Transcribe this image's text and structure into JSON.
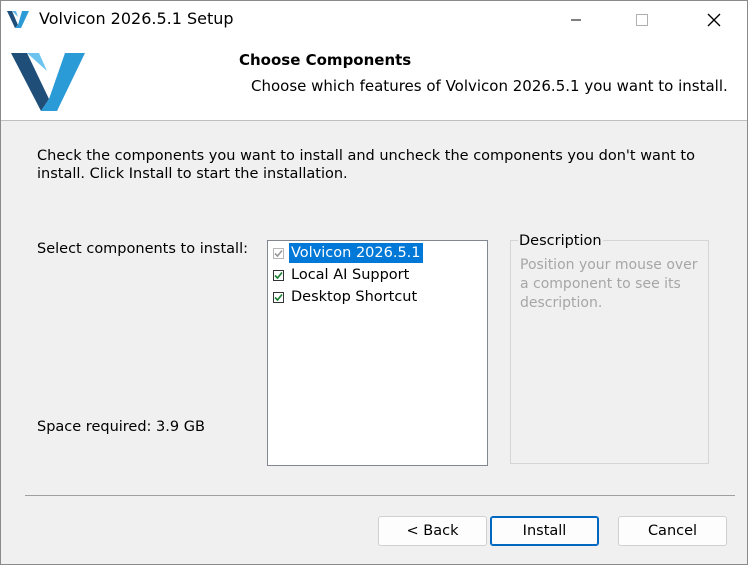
{
  "window": {
    "title": "Volvicon 2026.5.1 Setup"
  },
  "header": {
    "title": "Choose Components",
    "subtitle": "Choose which features of Volvicon 2026.5.1 you want to install."
  },
  "body": {
    "intro": "Check the components you want to install and uncheck the components you don't want to install. Click Install to start the installation.",
    "select_label": "Select components to install:",
    "space_required": "Space required: 3.9 GB"
  },
  "components": [
    {
      "label": "Volvicon 2026.5.1",
      "checked": true,
      "disabled": true,
      "selected": true
    },
    {
      "label": "Local AI Support",
      "checked": true,
      "disabled": false,
      "selected": false
    },
    {
      "label": "Desktop Shortcut",
      "checked": true,
      "disabled": false,
      "selected": false
    }
  ],
  "description": {
    "title": "Description",
    "text": "Position your mouse over a component to see its description."
  },
  "buttons": {
    "back": "< Back",
    "install": "Install",
    "cancel": "Cancel"
  },
  "colors": {
    "selection": "#0078d7",
    "logo_dark": "#1f4e79",
    "logo_light": "#2b9bd7",
    "default_button_border": "#0067c0"
  },
  "icons": {
    "app": "volvicon-logo-icon",
    "minimize": "minimize-icon",
    "maximize": "maximize-icon",
    "close": "close-icon",
    "check": "checkmark-icon"
  }
}
